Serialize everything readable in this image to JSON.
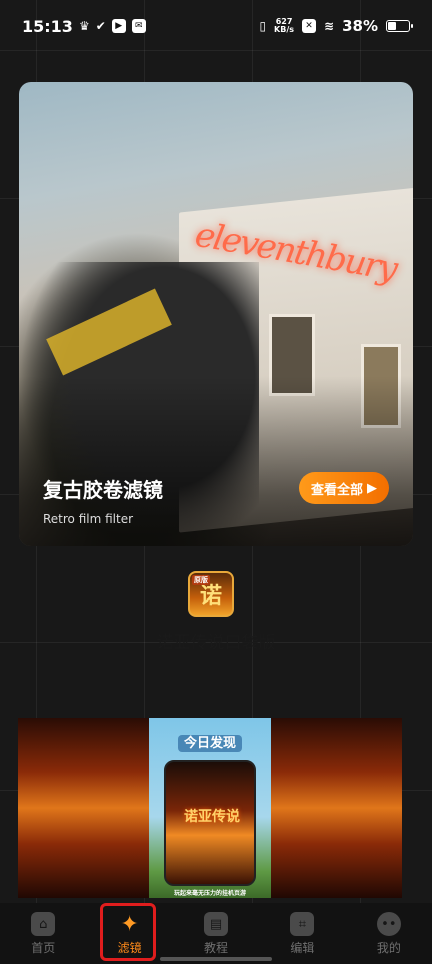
{
  "status_bar": {
    "time": "15:13",
    "net_speed_value": "627",
    "net_speed_unit": "KB/s",
    "battery": "38%"
  },
  "hero": {
    "title": "复古胶卷滤镜",
    "subtitle": "Retro film filter",
    "view_all": "查看全部",
    "neon_sign": "eleventhbury"
  },
  "ad": {
    "logo_tag": "原版",
    "logo_text": "诺",
    "app_name": "诺亚传说口袋版",
    "description": "",
    "footnote": ""
  },
  "banner": {
    "poster_title": "今日发现",
    "game_title": "诺亚传说",
    "caption": "玩起来毫无压力的挂机页游"
  },
  "nav": {
    "items": [
      {
        "label": "首页",
        "icon": "home-icon"
      },
      {
        "label": "滤镜",
        "icon": "magic-wand-icon"
      },
      {
        "label": "教程",
        "icon": "book-icon"
      },
      {
        "label": "编辑",
        "icon": "crop-icon"
      },
      {
        "label": "我的",
        "icon": "profile-icon"
      }
    ],
    "active_index": 1
  },
  "colors": {
    "accent": "#ff8a1a",
    "highlight_box": "#e01d1d"
  }
}
